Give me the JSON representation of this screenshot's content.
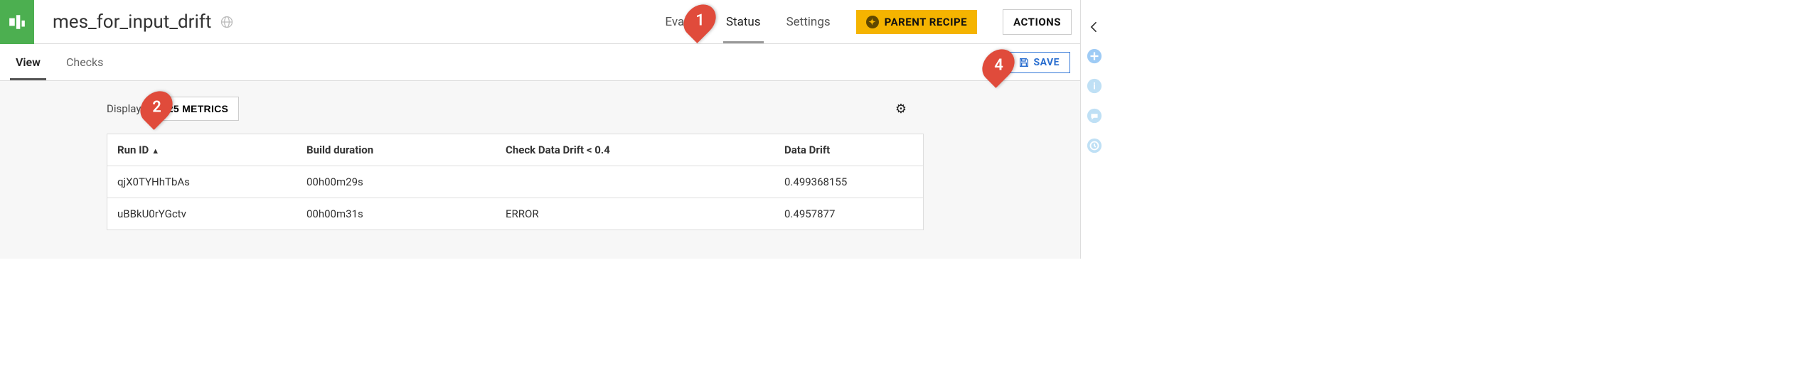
{
  "header": {
    "title": "mes_for_input_drift",
    "nav": {
      "evaluation": "Evalua",
      "status": "Status",
      "settings": "Settings"
    },
    "parent_recipe_label": "PARENT RECIPE",
    "actions_label": "ACTIONS"
  },
  "subnav": {
    "view": "View",
    "checks": "Checks",
    "save": "SAVE"
  },
  "controls": {
    "display_label": "Display",
    "metrics_button": "3/25 METRICS"
  },
  "table": {
    "columns": {
      "run_id": "Run ID",
      "build_duration": "Build duration",
      "check_drift": "Check Data Drift < 0.4",
      "data_drift": "Data Drift"
    },
    "rows": [
      {
        "run_id": "qjX0TYHhTbAs",
        "build_duration": "00h00m29s",
        "check_drift": "",
        "data_drift": "0.499368155"
      },
      {
        "run_id": "uBBkU0rYGctv",
        "build_duration": "00h00m31s",
        "check_drift": "ERROR",
        "data_drift": "0.4957877"
      }
    ]
  },
  "callouts": {
    "one": "1",
    "two": "2",
    "four": "4"
  }
}
